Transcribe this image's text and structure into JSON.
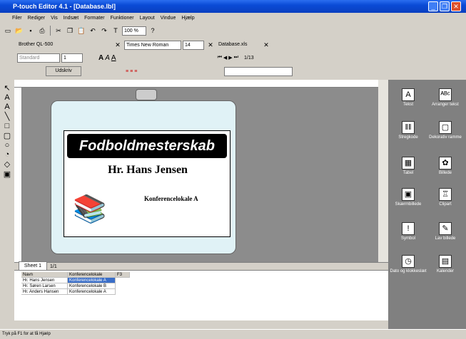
{
  "window": {
    "title": "P-touch Editor 4.1 - [Database.lbl]",
    "minimize": "_",
    "maximize": "❐",
    "close": "✕"
  },
  "menu": [
    "Filer",
    "Rediger",
    "Vis",
    "Indsæt",
    "Formater",
    "Funktioner",
    "Layout",
    "Vindue",
    "Hjælp"
  ],
  "toolbar1": {
    "zoom": "100 %"
  },
  "toolbar2": {
    "printer": "Brother QL-500",
    "mode": "Standard",
    "copies": "1",
    "print_label": "Udskriv",
    "font": "Times New Roman",
    "size": "14",
    "database_file": "Database.xls",
    "record": "1/13"
  },
  "label": {
    "header": "Fodboldmesterskab",
    "name": "Hr. Hans Jensen",
    "location": "Konferencelokale A"
  },
  "sheet": {
    "tab": "Sheet 1",
    "page": "1/1"
  },
  "grid": {
    "headers": [
      "Navn",
      "Konferencelokale",
      "F3"
    ],
    "rows": [
      [
        "Hr. Hans Jensen",
        "Konferencelokale A",
        ""
      ],
      [
        "Hr. Søren Larsen",
        "Konferencelokale B",
        ""
      ],
      [
        "Hr. Anders Hansen",
        "Konferencelokale A",
        ""
      ]
    ]
  },
  "panel": [
    {
      "label": "Tekst",
      "icon": "A"
    },
    {
      "label": "Arranger tekst",
      "icon": "ᴬᴮᶜ"
    },
    {
      "label": "Stregkode",
      "icon": "‖‖"
    },
    {
      "label": "Dekorativ ramme",
      "icon": "▢"
    },
    {
      "label": "Tabel",
      "icon": "▦"
    },
    {
      "label": "Billede",
      "icon": "✿"
    },
    {
      "label": "Skærmbillede",
      "icon": "▣"
    },
    {
      "label": "Clipart",
      "icon": "♖"
    },
    {
      "label": "Symbol",
      "icon": "!"
    },
    {
      "label": "Lav billede",
      "icon": "✎"
    },
    {
      "label": "Dato og klokkeslæt",
      "icon": "◷"
    },
    {
      "label": "Kalender",
      "icon": "▤"
    }
  ],
  "status": "Tryk på F1 for at få Hjælp"
}
